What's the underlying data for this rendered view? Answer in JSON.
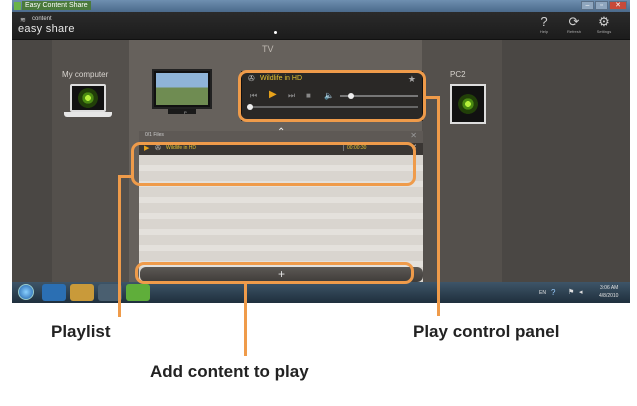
{
  "window": {
    "title": "Easy Content Share",
    "buttons": [
      "–",
      "▫",
      "✕"
    ]
  },
  "appbar": {
    "logo_top": "content",
    "logo_main": "easy share",
    "tools": [
      {
        "glyph": "?",
        "label": "Help",
        "icon": "help-icon"
      },
      {
        "glyph": "⟳",
        "label": "Refresh",
        "icon": "refresh-icon"
      },
      {
        "glyph": "⚙",
        "label": "Settings",
        "icon": "gear-icon"
      }
    ]
  },
  "devices": {
    "center": "TV",
    "left": "My computer",
    "right": "PC2",
    "tv_caption": "P"
  },
  "player": {
    "title": "Wildlife in HD",
    "volume_fraction": 0.05,
    "progress_fraction": 0.0
  },
  "playlist": {
    "caption": "0/1 Files",
    "items": [
      {
        "name": "Wildlife in HD",
        "duration": "00:00:30"
      }
    ],
    "add_label": "+"
  },
  "taskbar": {
    "language": "EN",
    "time": "3:06 AM",
    "date": "4/8/2010"
  },
  "annotations": {
    "playlist": "Playlist",
    "play_control": "Play control panel",
    "add_content": "Add content to play"
  },
  "colors": {
    "highlight": "#ef9b4a",
    "title_text": "#e3c233",
    "play_accent": "#e8a21a"
  }
}
